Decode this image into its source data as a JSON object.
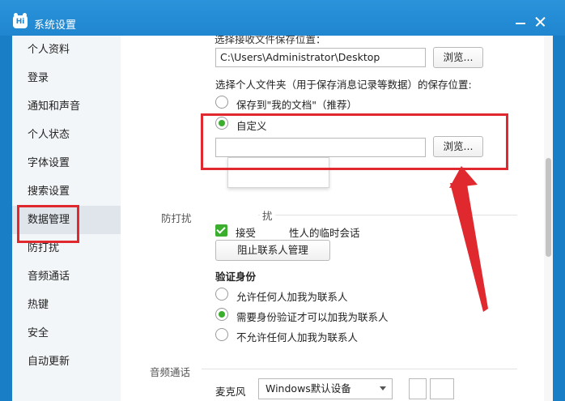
{
  "window": {
    "title": "系统设置",
    "app_icon_text": "Hi"
  },
  "sidebar": {
    "items": [
      {
        "label": "个人资料",
        "active": false
      },
      {
        "label": "登录",
        "active": false
      },
      {
        "label": "通知和声音",
        "active": false
      },
      {
        "label": "个人状态",
        "active": false
      },
      {
        "label": "字体设置",
        "active": false
      },
      {
        "label": "搜索设置",
        "active": false
      },
      {
        "label": "数据管理",
        "active": true
      },
      {
        "label": "防打扰",
        "active": false
      },
      {
        "label": "音频通话",
        "active": false
      },
      {
        "label": "热键",
        "active": false
      },
      {
        "label": "安全",
        "active": false
      },
      {
        "label": "自动更新",
        "active": false
      }
    ]
  },
  "data_mgmt": {
    "cut_text": "选择接收文件保存位置：",
    "path_value": "C:\\Users\\Administrator\\Desktop",
    "browse_label": "浏览...",
    "folder_question": "选择个人文件夹（用于保存消息记录等数据）的保存位置:",
    "option_my_docs": "保存到\"我的文档\"（推荐）",
    "option_custom": "自定义",
    "custom_path_value": "",
    "browse_label_2": "浏览..."
  },
  "anti_disturb": {
    "section_title": "防打扰",
    "section_title_fragment": "扰",
    "receive_part1": "接受",
    "receive_part2": "性人的临时会话",
    "block_button": "阻止联系人管理",
    "verify_title": "验证身份",
    "verify_options": [
      {
        "label": "允许任何人加我为联系人",
        "selected": false
      },
      {
        "label": "需要身份验证才可以加我为联系人",
        "selected": true
      },
      {
        "label": "不允许任何人加我为联系人",
        "selected": false
      }
    ]
  },
  "audio": {
    "section_title": "音频通话",
    "mic_label": "麦克风",
    "mic_device": "Windows默认设备"
  },
  "colors": {
    "accent_blue": "#1f86cf",
    "highlight_red": "#e0292f",
    "radio_green": "#3cae2e"
  }
}
